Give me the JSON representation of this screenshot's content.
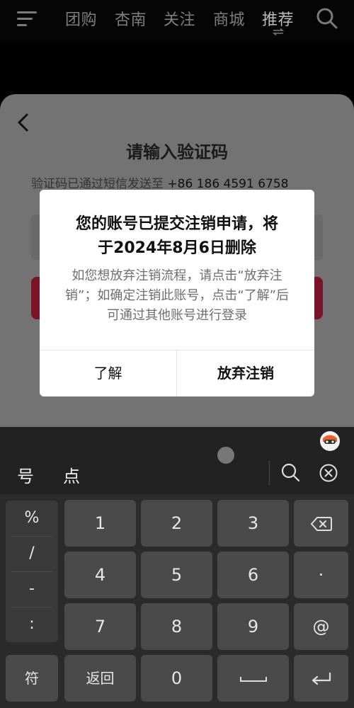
{
  "nav": {
    "tabs": [
      "团购",
      "杏南",
      "关注",
      "商城",
      "推荐"
    ],
    "active_tab": "推荐"
  },
  "sheet": {
    "title": "请输入验证码",
    "subtitle_prefix": "验证码已通过短信发送至",
    "phone": "+86 186 4591 6758"
  },
  "dialog": {
    "title_line1": "您的账号已提交注销申请，将",
    "title_line2": "于2024年8月6日删除",
    "body": "如您想放弃注销流程，请点击“放弃注销”；如确定注销此账号，点击“了解”后可通过其他账号进行登录",
    "btn_understand": "了解",
    "btn_cancel_deletion": "放弃注销"
  },
  "keyboard": {
    "candidates": [
      "号",
      "点"
    ],
    "symbols": [
      "%",
      "/",
      "-",
      ":"
    ],
    "rows": [
      [
        "1",
        "2",
        "3"
      ],
      [
        "4",
        "5",
        "6"
      ],
      [
        "7",
        "8",
        "9"
      ]
    ],
    "period_key": "·",
    "at_key": "@",
    "symbol_key": "符",
    "return_key": "返回",
    "zero_key": "0"
  },
  "colors": {
    "accent_red": "#7b1329",
    "sheet_bg": "#737373",
    "keyboard_bg": "#2b2b2b"
  }
}
